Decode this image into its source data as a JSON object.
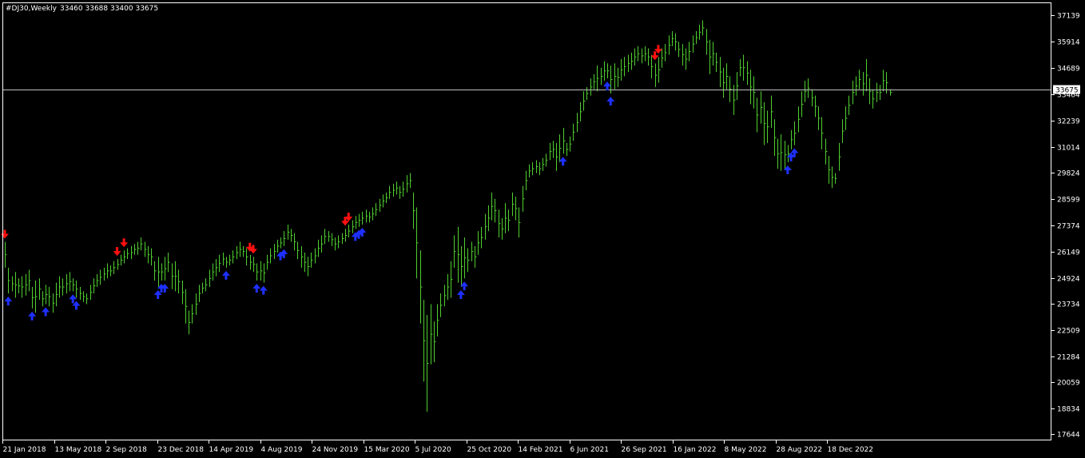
{
  "header": {
    "symbol": "#DJ30,Weekly",
    "ohlc": "33460 33688 33400 33675"
  },
  "colors": {
    "background": "#000000",
    "frame": "#ffffff",
    "bars": "#4fcf2f",
    "price_line": "#c0c0c0",
    "up_arrow": "#1e30ff",
    "down_arrow": "#ff1010",
    "price_label_bg": "#ffffff",
    "price_label_text": "#000000"
  },
  "chart_data": {
    "type": "ohlc",
    "title": "#DJ30,Weekly",
    "ohlc_text": "33460 33688 33400 33675",
    "current_price": 33675,
    "current_price_label": "33675",
    "ylim": [
      17400,
      37700
    ],
    "y_ticks": [
      "37139",
      "35914",
      "34689",
      "33464",
      "32239",
      "31014",
      "29824",
      "28599",
      "27374",
      "26149",
      "24924",
      "23734",
      "22509",
      "21284",
      "20059",
      "18834",
      "17644"
    ],
    "x_ticks": [
      "21 Jan 2018",
      "13 May 2018",
      "2 Sep 2018",
      "23 Dec 2018",
      "14 Apr 2019",
      "4 Aug 2019",
      "24 Nov 2019",
      "15 Mar 2020",
      "5 Jul 2020",
      "25 Oct 2020",
      "14 Feb 2021",
      "6 Jun 2021",
      "26 Sep 2021",
      "16 Jan 2022",
      "8 May 2022",
      "28 Aug 2022",
      "18 Dec 2022"
    ],
    "grid": false,
    "series": [
      {
        "values": [
          [
            26600,
            25400
          ],
          [
            25400,
            24200
          ],
          [
            25000,
            24300
          ],
          [
            25200,
            24000
          ],
          [
            24900,
            24200
          ],
          [
            25000,
            24000
          ],
          [
            25100,
            24100
          ],
          [
            25300,
            24300
          ],
          [
            24500,
            23500
          ],
          [
            24800,
            23300
          ],
          [
            24900,
            23900
          ],
          [
            24300,
            23600
          ],
          [
            24600,
            23700
          ],
          [
            24500,
            23600
          ],
          [
            24200,
            23300
          ],
          [
            24700,
            23600
          ],
          [
            25000,
            24000
          ],
          [
            24900,
            24100
          ],
          [
            25100,
            24200
          ],
          [
            25200,
            24300
          ],
          [
            24900,
            24300
          ],
          [
            24800,
            24000
          ],
          [
            24500,
            23900
          ],
          [
            24300,
            23800
          ],
          [
            24200,
            23700
          ],
          [
            24600,
            23900
          ],
          [
            24900,
            24200
          ],
          [
            25100,
            24500
          ],
          [
            25300,
            24600
          ],
          [
            25400,
            24800
          ],
          [
            25600,
            24900
          ],
          [
            25500,
            25000
          ],
          [
            25700,
            25100
          ],
          [
            25800,
            25300
          ],
          [
            26000,
            25500
          ],
          [
            26200,
            25600
          ],
          [
            26300,
            25800
          ],
          [
            26400,
            25800
          ],
          [
            26500,
            26000
          ],
          [
            26600,
            26000
          ],
          [
            26800,
            26200
          ],
          [
            26600,
            25900
          ],
          [
            26400,
            25600
          ],
          [
            26300,
            25500
          ],
          [
            25700,
            24800
          ],
          [
            25900,
            24500
          ],
          [
            25600,
            24800
          ],
          [
            25900,
            24800
          ],
          [
            26100,
            25200
          ],
          [
            25600,
            24400
          ],
          [
            25700,
            24300
          ],
          [
            25300,
            24200
          ],
          [
            24800,
            23700
          ],
          [
            24400,
            22800
          ],
          [
            23400,
            22300
          ],
          [
            23700,
            22800
          ],
          [
            24200,
            23200
          ],
          [
            24600,
            23800
          ],
          [
            24700,
            24200
          ],
          [
            24900,
            24300
          ],
          [
            25300,
            24500
          ],
          [
            25600,
            24800
          ],
          [
            25800,
            25000
          ],
          [
            26000,
            25200
          ],
          [
            26100,
            25500
          ],
          [
            25900,
            25400
          ],
          [
            26000,
            25500
          ],
          [
            26200,
            25600
          ],
          [
            26400,
            25800
          ],
          [
            26600,
            25900
          ],
          [
            26400,
            25900
          ],
          [
            26300,
            25500
          ],
          [
            26000,
            25300
          ],
          [
            25900,
            25200
          ],
          [
            25600,
            24800
          ],
          [
            25700,
            24800
          ],
          [
            25600,
            24700
          ],
          [
            26000,
            25300
          ],
          [
            26300,
            25600
          ],
          [
            26500,
            25800
          ],
          [
            26700,
            26100
          ],
          [
            26800,
            26300
          ],
          [
            27100,
            26400
          ],
          [
            27400,
            26700
          ],
          [
            27200,
            26600
          ],
          [
            27000,
            26200
          ],
          [
            26600,
            25800
          ],
          [
            26400,
            25400
          ],
          [
            26100,
            25200
          ],
          [
            25900,
            25000
          ],
          [
            26100,
            25400
          ],
          [
            26300,
            25600
          ],
          [
            26700,
            25900
          ],
          [
            26900,
            26100
          ],
          [
            27200,
            26500
          ],
          [
            27100,
            26600
          ],
          [
            27000,
            26400
          ],
          [
            26800,
            26200
          ],
          [
            26900,
            26300
          ],
          [
            27000,
            26500
          ],
          [
            27200,
            26600
          ],
          [
            27400,
            26800
          ],
          [
            27600,
            27000
          ],
          [
            27800,
            27200
          ],
          [
            27900,
            27300
          ],
          [
            28000,
            27400
          ],
          [
            28100,
            27500
          ],
          [
            28000,
            27500
          ],
          [
            28200,
            27600
          ],
          [
            28400,
            27800
          ],
          [
            28600,
            28000
          ],
          [
            28800,
            28200
          ],
          [
            28900,
            28400
          ],
          [
            29200,
            28600
          ],
          [
            29300,
            28700
          ],
          [
            29400,
            28800
          ],
          [
            29200,
            28600
          ],
          [
            29400,
            28700
          ],
          [
            29700,
            28900
          ],
          [
            29800,
            29100
          ],
          [
            28900,
            27200
          ],
          [
            28200,
            24900
          ],
          [
            26200,
            22800
          ],
          [
            23900,
            20100
          ],
          [
            23200,
            18700
          ],
          [
            23700,
            20900
          ],
          [
            22900,
            21000
          ],
          [
            23700,
            22200
          ],
          [
            24200,
            23100
          ],
          [
            24600,
            23600
          ],
          [
            25100,
            23900
          ],
          [
            25700,
            24000
          ],
          [
            26900,
            25400
          ],
          [
            27300,
            24700
          ],
          [
            26400,
            24500
          ],
          [
            26800,
            24900
          ],
          [
            26300,
            25200
          ],
          [
            26600,
            25700
          ],
          [
            26400,
            25400
          ],
          [
            27100,
            26000
          ],
          [
            27300,
            26300
          ],
          [
            27900,
            26700
          ],
          [
            28300,
            27100
          ],
          [
            28900,
            27600
          ],
          [
            28600,
            27500
          ],
          [
            28100,
            26800
          ],
          [
            27700,
            26700
          ],
          [
            28400,
            27000
          ],
          [
            28100,
            27100
          ],
          [
            28900,
            27800
          ],
          [
            28700,
            27600
          ],
          [
            28200,
            26800
          ],
          [
            29200,
            28000
          ],
          [
            29900,
            29000
          ],
          [
            30200,
            29600
          ],
          [
            30300,
            29700
          ],
          [
            30400,
            29800
          ],
          [
            30300,
            29700
          ],
          [
            30500,
            29900
          ],
          [
            30700,
            30100
          ],
          [
            31200,
            30400
          ],
          [
            31300,
            30500
          ],
          [
            31200,
            29900
          ],
          [
            31600,
            30300
          ],
          [
            31900,
            30700
          ],
          [
            31200,
            30600
          ],
          [
            31500,
            30800
          ],
          [
            32100,
            31300
          ],
          [
            32600,
            31700
          ],
          [
            33100,
            32200
          ],
          [
            33600,
            32700
          ],
          [
            33800,
            33200
          ],
          [
            34200,
            33400
          ],
          [
            34400,
            33700
          ],
          [
            34800,
            33600
          ],
          [
            34700,
            33900
          ],
          [
            35000,
            34100
          ],
          [
            34900,
            34200
          ],
          [
            34800,
            33500
          ],
          [
            34900,
            33700
          ],
          [
            34700,
            33800
          ],
          [
            35100,
            34100
          ],
          [
            35200,
            34300
          ],
          [
            35300,
            34500
          ],
          [
            35400,
            34600
          ],
          [
            35600,
            34800
          ],
          [
            35700,
            35000
          ],
          [
            35600,
            34900
          ],
          [
            35700,
            35000
          ],
          [
            35600,
            34800
          ],
          [
            35300,
            34200
          ],
          [
            34900,
            33800
          ],
          [
            35200,
            34000
          ],
          [
            35600,
            34700
          ],
          [
            35800,
            35000
          ],
          [
            36200,
            35300
          ],
          [
            36400,
            35700
          ],
          [
            36300,
            35500
          ],
          [
            35900,
            35200
          ],
          [
            35800,
            34800
          ],
          [
            35600,
            34600
          ],
          [
            35900,
            35000
          ],
          [
            36200,
            35400
          ],
          [
            36400,
            35800
          ],
          [
            36700,
            36000
          ],
          [
            36900,
            36200
          ],
          [
            36500,
            35300
          ],
          [
            36000,
            34400
          ],
          [
            35900,
            34800
          ],
          [
            35400,
            34500
          ],
          [
            35200,
            33800
          ],
          [
            34700,
            33300
          ],
          [
            34900,
            33700
          ],
          [
            34300,
            33100
          ],
          [
            33900,
            32500
          ],
          [
            34500,
            33200
          ],
          [
            35100,
            34300
          ],
          [
            35300,
            34100
          ],
          [
            35000,
            33900
          ],
          [
            34600,
            33000
          ],
          [
            34300,
            32800
          ],
          [
            33300,
            31700
          ],
          [
            33600,
            32100
          ],
          [
            33100,
            31100
          ],
          [
            32700,
            31200
          ],
          [
            33400,
            31900
          ],
          [
            32300,
            30600
          ],
          [
            31400,
            30000
          ],
          [
            31600,
            29900
          ],
          [
            31300,
            30000
          ],
          [
            31100,
            30300
          ],
          [
            31800,
            30900
          ],
          [
            32200,
            31100
          ],
          [
            32900,
            31700
          ],
          [
            33600,
            32400
          ],
          [
            34100,
            33100
          ],
          [
            34200,
            33300
          ],
          [
            33700,
            32900
          ],
          [
            33400,
            32400
          ],
          [
            32900,
            31800
          ],
          [
            32400,
            30900
          ],
          [
            31400,
            30200
          ],
          [
            30600,
            29300
          ],
          [
            30100,
            29100
          ],
          [
            29800,
            29300
          ],
          [
            31200,
            29900
          ],
          [
            32300,
            31200
          ],
          [
            32900,
            31800
          ],
          [
            33400,
            32500
          ],
          [
            34100,
            33000
          ],
          [
            34300,
            33400
          ],
          [
            34600,
            33700
          ],
          [
            34500,
            33400
          ],
          [
            35100,
            33600
          ],
          [
            34200,
            33000
          ],
          [
            33700,
            32800
          ],
          [
            34000,
            33100
          ],
          [
            33900,
            33200
          ],
          [
            34600,
            33600
          ],
          [
            34500,
            33500
          ],
          [
            33700,
            33400
          ]
        ]
      }
    ],
    "signals": [
      {
        "type": "sell",
        "week": 0
      },
      {
        "type": "buy",
        "week": 1
      },
      {
        "type": "buy",
        "week": 8
      },
      {
        "type": "buy",
        "week": 12
      },
      {
        "type": "buy",
        "week": 20
      },
      {
        "type": "buy",
        "week": 21
      },
      {
        "type": "sell",
        "week": 33
      },
      {
        "type": "sell",
        "week": 35
      },
      {
        "type": "buy",
        "week": 45
      },
      {
        "type": "buy",
        "week": 46
      },
      {
        "type": "buy",
        "week": 47
      },
      {
        "type": "buy",
        "week": 65
      },
      {
        "type": "sell",
        "week": 72
      },
      {
        "type": "sell",
        "week": 73
      },
      {
        "type": "buy",
        "week": 74
      },
      {
        "type": "buy",
        "week": 76
      },
      {
        "type": "buy",
        "week": 81
      },
      {
        "type": "buy",
        "week": 82
      },
      {
        "type": "sell",
        "week": 100
      },
      {
        "type": "sell",
        "week": 101
      },
      {
        "type": "buy",
        "week": 103
      },
      {
        "type": "buy",
        "week": 104
      },
      {
        "type": "buy",
        "week": 105
      },
      {
        "type": "buy",
        "week": 134
      },
      {
        "type": "buy",
        "week": 135
      },
      {
        "type": "buy",
        "week": 164
      },
      {
        "type": "buy",
        "week": 177
      },
      {
        "type": "buy",
        "week": 178
      },
      {
        "type": "sell",
        "week": 191
      },
      {
        "type": "sell",
        "week": 192
      },
      {
        "type": "buy",
        "week": 230
      },
      {
        "type": "buy",
        "week": 231
      },
      {
        "type": "buy",
        "week": 232
      }
    ]
  }
}
